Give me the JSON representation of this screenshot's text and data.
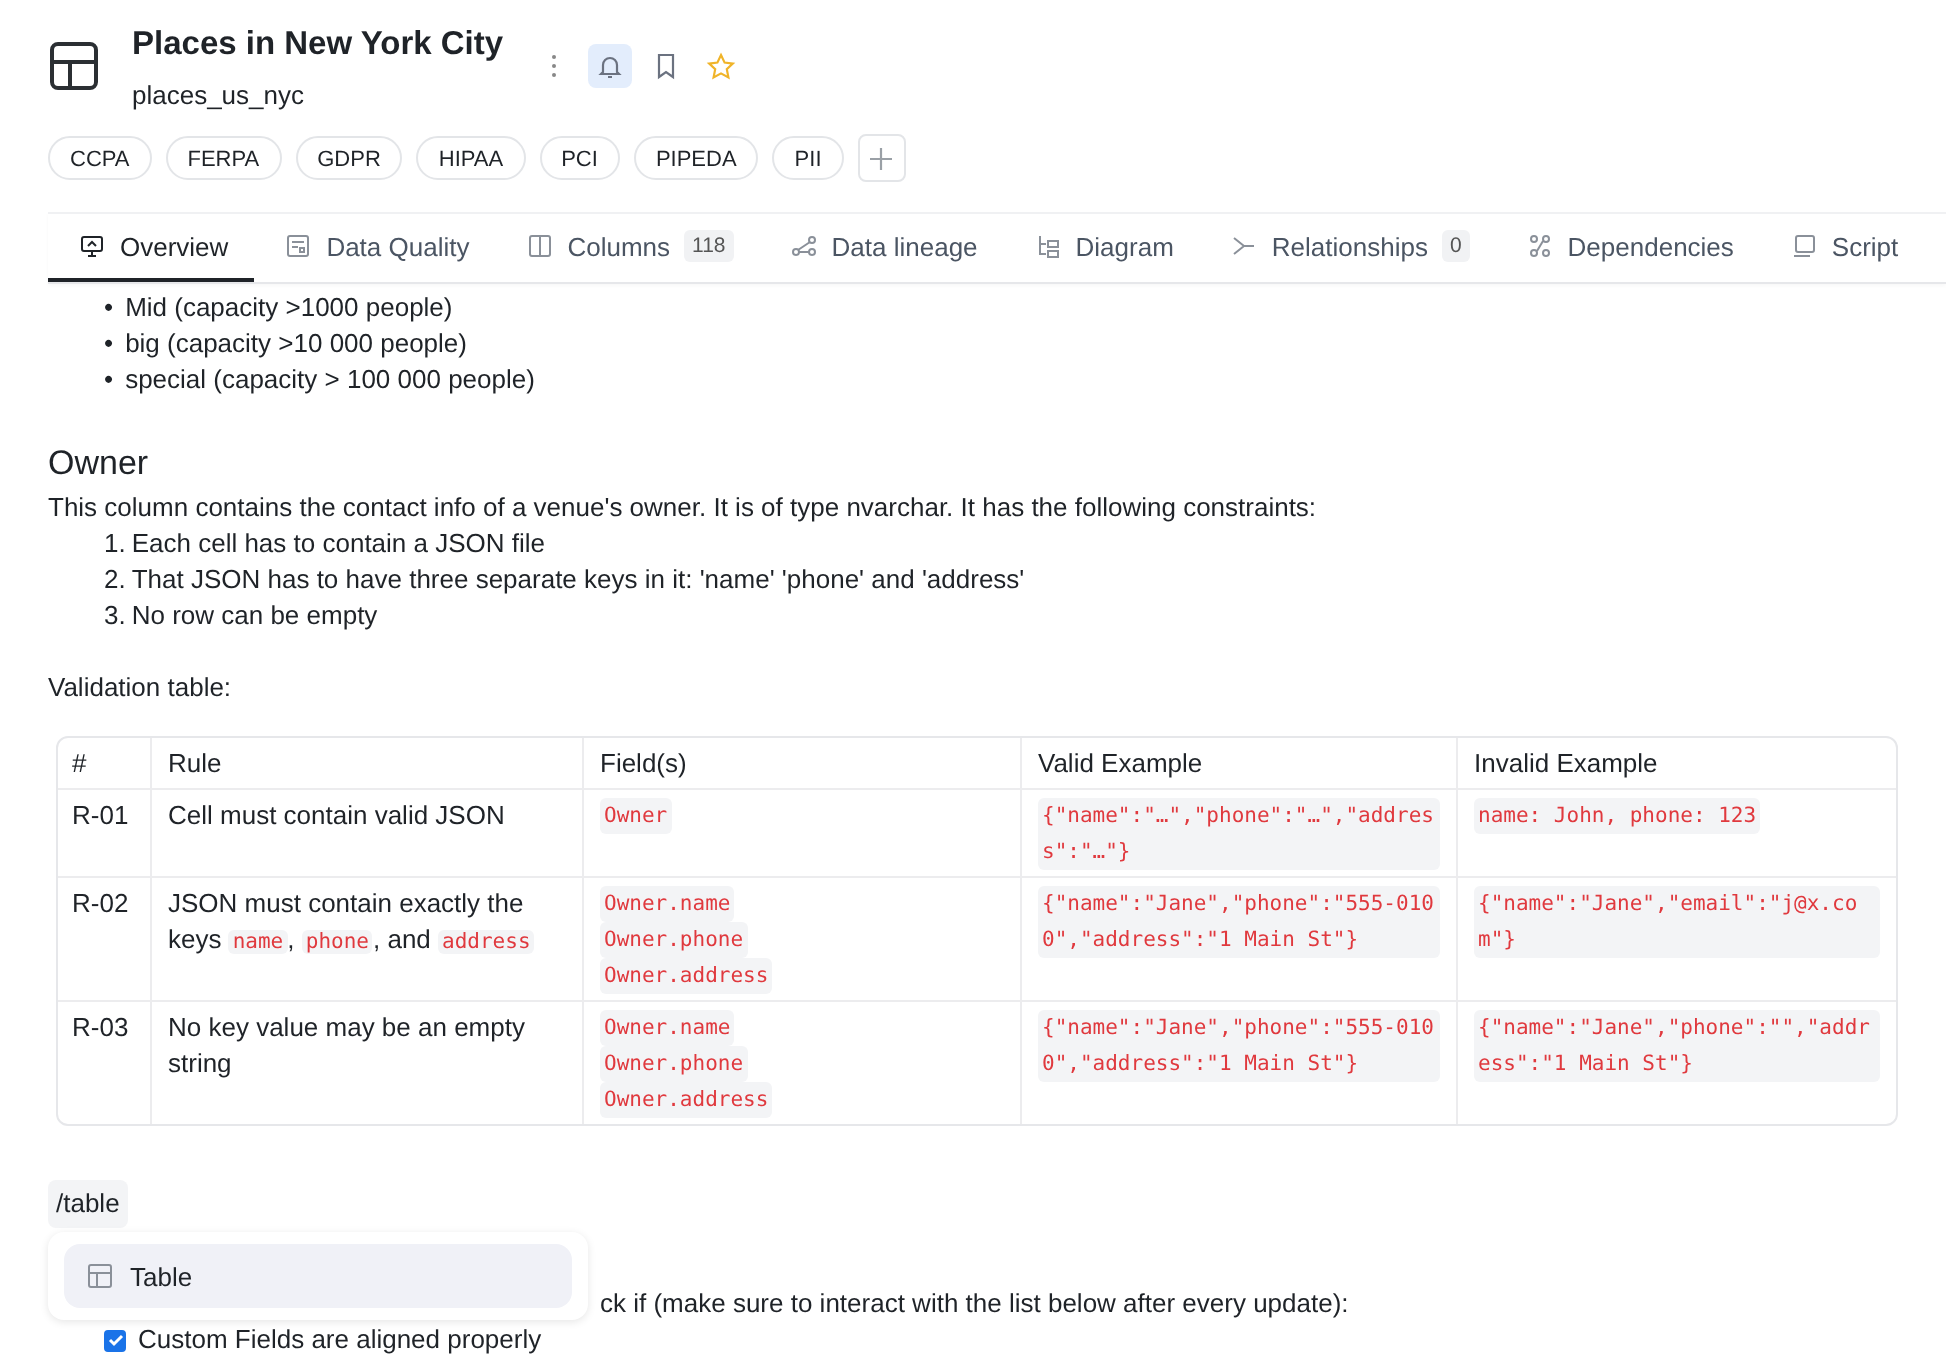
{
  "header": {
    "title": "Places in New York City",
    "subtitle": "places_us_nyc",
    "notifications_on": true
  },
  "tags": [
    "CCPA",
    "FERPA",
    "GDPR",
    "HIPAA",
    "PCI",
    "PIPEDA",
    "PII"
  ],
  "tabs": [
    {
      "label": "Overview",
      "selected": true
    },
    {
      "label": "Data Quality",
      "selected": false
    },
    {
      "label": "Columns",
      "count": "118",
      "selected": false
    },
    {
      "label": "Data lineage",
      "selected": false
    },
    {
      "label": "Diagram",
      "selected": false
    },
    {
      "label": "Relationships",
      "count": "0",
      "selected": false
    },
    {
      "label": "Dependencies",
      "selected": false
    },
    {
      "label": "Script",
      "selected": false
    }
  ],
  "bullets": [
    {
      "marker": "•",
      "text": "Mid (capacity >1000 people)"
    },
    {
      "marker": "•",
      "text": "big (capacity >10 000 people)"
    },
    {
      "marker": "•",
      "text": "special (capacity > 100 000 people)"
    }
  ],
  "section": {
    "heading": "Owner",
    "intro": "This column contains the contact info of a venue's owner. It is of type nvarchar. It has the following constraints:",
    "constraints": [
      {
        "marker": "1.",
        "text": "Each cell has to contain a JSON file"
      },
      {
        "marker": "2.",
        "text": "That JSON has to have three separate keys in it: 'name' 'phone' and 'address'"
      },
      {
        "marker": "3.",
        "text": "No row can be empty"
      }
    ],
    "table_caption": "Validation table:"
  },
  "table": {
    "columns": [
      "#",
      "Rule",
      "Field(s)",
      "Valid Example",
      "Invalid Example"
    ],
    "rows": [
      {
        "id": "R-01",
        "rule": [
          {
            "kind": "text",
            "text": "Cell must contain valid JSON"
          }
        ],
        "fields": [
          "Owner"
        ],
        "valid": "{\"name\":\"…\",\"phone\":\"…\",\"address\":\"…\"}",
        "invalid": "name: John, phone: 123"
      },
      {
        "id": "R-02",
        "rule": [
          {
            "kind": "text",
            "text": "JSON must contain exactly the keys "
          },
          {
            "kind": "code",
            "text": "name"
          },
          {
            "kind": "text",
            "text": ", "
          },
          {
            "kind": "code",
            "text": "phone"
          },
          {
            "kind": "text",
            "text": ", and "
          },
          {
            "kind": "code",
            "text": "address"
          }
        ],
        "fields": [
          "Owner.name",
          "Owner.phone",
          "Owner.address"
        ],
        "valid": "{\"name\":\"Jane\",\"phone\":\"555-0100\",\"address\":\"1 Main St\"}",
        "invalid": "{\"name\":\"Jane\",\"email\":\"j@x.com\"}"
      },
      {
        "id": "R-03",
        "rule": [
          {
            "kind": "text",
            "text": "No key value may be an empty string"
          }
        ],
        "fields": [
          "Owner.name",
          "Owner.phone",
          "Owner.address"
        ],
        "valid": "{\"name\":\"Jane\",\"phone\":\"555-0100\",\"address\":\"1 Main St\"}",
        "invalid": "{\"name\":\"Jane\",\"phone\":\"\",\"address\":\"1 Main St\"}"
      }
    ]
  },
  "command_chip": "/table",
  "partial_text": "ck if (make sure to interact with the list below after every update):",
  "checklist": [
    {
      "label": "Custom Fields are aligned properly",
      "checked": true
    }
  ],
  "popup": {
    "items": [
      {
        "label": "Table",
        "selected": true
      }
    ]
  }
}
